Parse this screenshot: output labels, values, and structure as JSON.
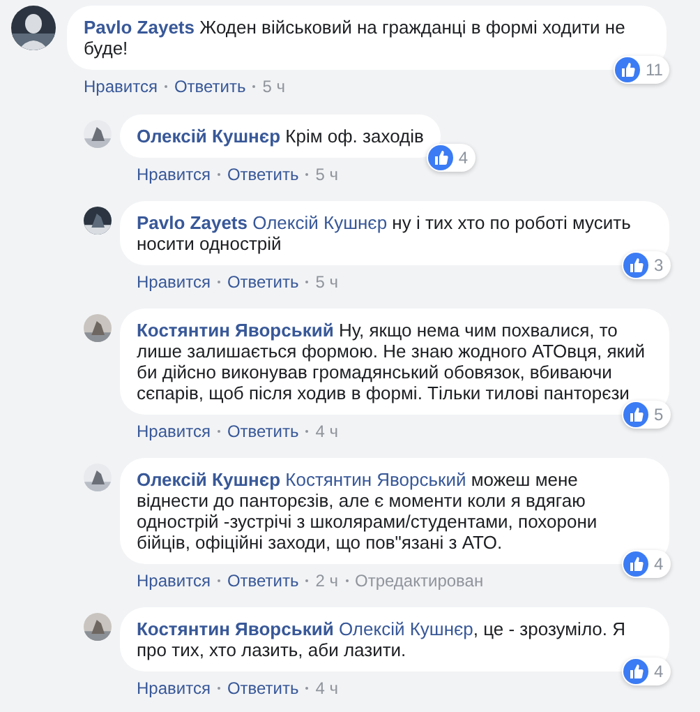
{
  "comments": [
    {
      "author": "Pavlo Zayets",
      "text": "Жоден військовий на гражданці в формі ходити не буде!",
      "likes": "11",
      "actions": [
        "Нравится",
        "Ответить"
      ],
      "time": "5 ч",
      "replies": [
        {
          "author": "Олексій Кушнєр",
          "text": "Крім оф. заходів",
          "likes": "4",
          "actions": [
            "Нравится",
            "Ответить"
          ],
          "time": "5 ч"
        },
        {
          "author": "Pavlo Zayets",
          "mention": "Олексій Кушнєр",
          "text": "ну і тих хто по роботі мусить носити однострій",
          "likes": "3",
          "actions": [
            "Нравится",
            "Ответить"
          ],
          "time": "5 ч"
        },
        {
          "author": "Костянтин Яворський",
          "text": "Ну, якщо нема чим похвалися, то лише залишається формою. Не знаю жодного АТОвця, який би дійсно виконував громадянський обовязок, вбиваючи сєпарів, щоб після ходив в формі. Тільки тилові панторєзи",
          "likes": "5",
          "actions": [
            "Нравится",
            "Ответить"
          ],
          "time": "4 ч"
        },
        {
          "author": "Олексій Кушнєр",
          "mention": "Костянтин Яворський",
          "text": "можеш мене віднести до панторєзів, але є моменти коли я вдягаю однострій -зустрічі з школярами/студентами, похорони бійців, офіційні заходи, що пов\"язані з АТО.",
          "likes": "4",
          "actions": [
            "Нравится",
            "Ответить"
          ],
          "time": "2 ч",
          "edited": "Отредактирован"
        },
        {
          "author": "Костянтин Яворський",
          "mention": "Олексій Кушнєр",
          "text": ", це - зрозуміло. Я про тих, хто лазить, аби лазити.",
          "likes": "4",
          "actions": [
            "Нравится",
            "Ответить"
          ],
          "time": "4 ч"
        }
      ]
    }
  ]
}
